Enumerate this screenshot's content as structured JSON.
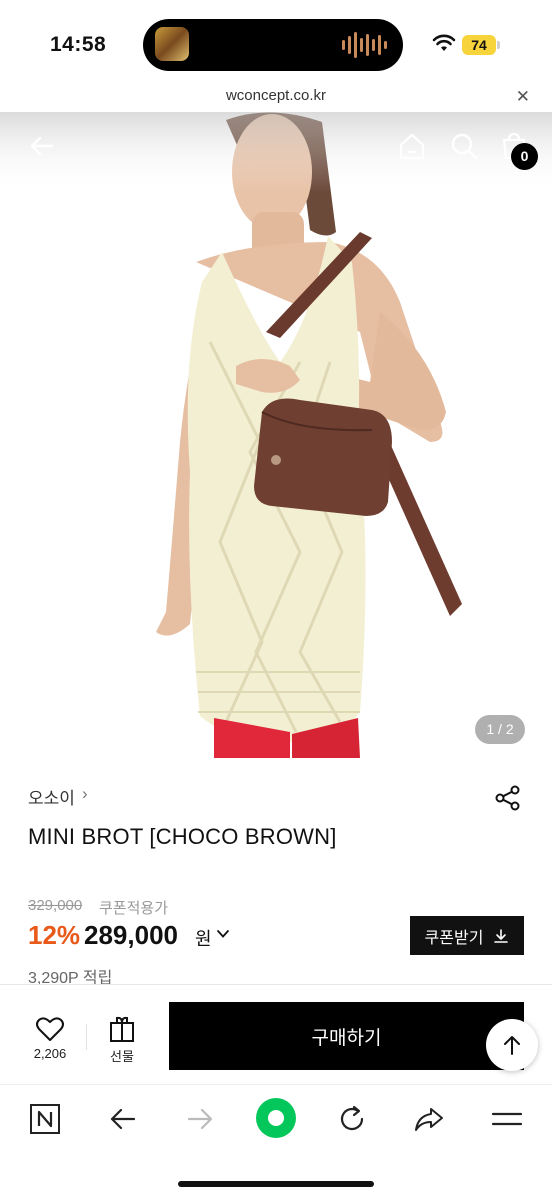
{
  "status_bar": {
    "time": "14:58",
    "battery": "74"
  },
  "browser": {
    "url": "wconcept.co.kr",
    "close_icon": "close-icon"
  },
  "product_nav": {
    "back_icon": "back-arrow-icon",
    "home_icon": "home-icon",
    "search_icon": "search-icon",
    "cart_icon": "cart-icon",
    "cart_count": "0"
  },
  "gallery": {
    "pager": "1 / 2"
  },
  "product": {
    "brand": "오소이",
    "brand_chevron": "›",
    "title": "MINI BROT [CHOCO BROWN]",
    "original_price": "329,000",
    "coupon_note": "쿠폰적용가",
    "discount": "12%",
    "price": "289,000",
    "currency": "원",
    "coupon_button": "쿠폰받기",
    "points": "3,290P 적립"
  },
  "actions": {
    "like_count": "2,206",
    "gift_label": "선물",
    "buy_label": "구매하기"
  },
  "colors": {
    "accent_discount": "#e8591a",
    "primary_dark": "#000000",
    "browser_green": "#03c75a"
  }
}
